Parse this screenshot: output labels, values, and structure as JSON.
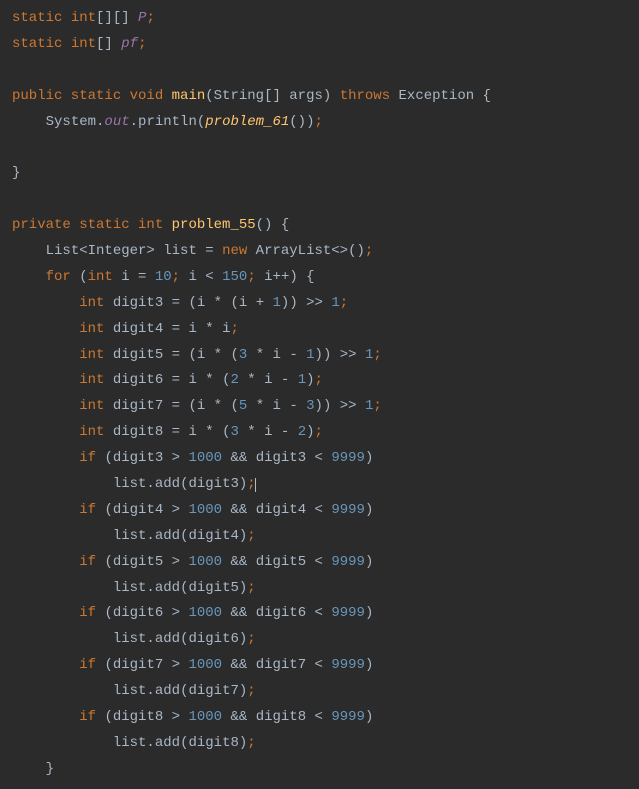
{
  "lines": {
    "l1": {
      "kw1": "static ",
      "kw2": "int",
      "br": "[][] ",
      "id": "P",
      "sc": ";"
    },
    "l2": {
      "kw1": "static ",
      "kw2": "int",
      "br": "[] ",
      "id": "pf",
      "sc": ";"
    },
    "l3": {
      "kw1": "public static ",
      "kw2": "void ",
      "mt": "main",
      "p1": "(",
      "t1": "String[] ",
      "id": "args",
      "p2": ") ",
      "kw3": "throws ",
      "t2": "Exception ",
      "br": "{"
    },
    "l4": {
      "indent": "    ",
      "id1": "System.",
      "fd": "out",
      "dot": ".",
      "mt": "println",
      "p1": "(",
      "fn": "problem_61",
      "p2": "())",
      "sc": ";"
    },
    "l5": {
      "br": "}"
    },
    "l6": {
      "kw1": "private static ",
      "kw2": "int ",
      "mt": "problem_55",
      "p1": "() ",
      "br": "{"
    },
    "l7": {
      "indent": "    ",
      "t1": "List<Integer> ",
      "id": "list ",
      "op": "= ",
      "kw": "new ",
      "t2": "ArrayList<>()",
      "sc": ";"
    },
    "l8": {
      "indent": "    ",
      "kw1": "for ",
      "p1": "(",
      "kw2": "int ",
      "id1": "i ",
      "op1": "= ",
      "n1": "10",
      "sc1": "; ",
      "id2": "i ",
      "op2": "< ",
      "n2": "150",
      "sc2": "; ",
      "id3": "i++) ",
      "br": "{"
    },
    "l9": {
      "indent": "        ",
      "kw": "int ",
      "id1": "digit3 ",
      "op1": "= ",
      "p1": "(i ",
      "op2": "* ",
      "p2": "(i ",
      "op3": "+ ",
      "n1": "1",
      "p3": ")) ",
      "op4": ">> ",
      "n2": "1",
      "sc": ";"
    },
    "l10": {
      "indent": "        ",
      "kw": "int ",
      "id1": "digit4 ",
      "op1": "= ",
      "id2": "i ",
      "op2": "* ",
      "id3": "i",
      "sc": ";"
    },
    "l11": {
      "indent": "        ",
      "kw": "int ",
      "id1": "digit5 ",
      "op1": "= ",
      "p1": "(i ",
      "op2": "* ",
      "p2": "(",
      "n1": "3 ",
      "op3": "* ",
      "id2": "i ",
      "op4": "- ",
      "n2": "1",
      "p3": ")) ",
      "op5": ">> ",
      "n3": "1",
      "sc": ";"
    },
    "l12": {
      "indent": "        ",
      "kw": "int ",
      "id1": "digit6 ",
      "op1": "= ",
      "id2": "i ",
      "op2": "* ",
      "p1": "(",
      "n1": "2 ",
      "op3": "* ",
      "id3": "i ",
      "op4": "- ",
      "n2": "1",
      "p2": ")",
      "sc": ";"
    },
    "l13": {
      "indent": "        ",
      "kw": "int ",
      "id1": "digit7 ",
      "op1": "= ",
      "p1": "(i ",
      "op2": "* ",
      "p2": "(",
      "n1": "5 ",
      "op3": "* ",
      "id2": "i ",
      "op4": "- ",
      "n2": "3",
      "p3": ")) ",
      "op5": ">> ",
      "n3": "1",
      "sc": ";"
    },
    "l14": {
      "indent": "        ",
      "kw": "int ",
      "id1": "digit8 ",
      "op1": "= ",
      "id2": "i ",
      "op2": "* ",
      "p1": "(",
      "n1": "3 ",
      "op3": "* ",
      "id3": "i ",
      "op4": "- ",
      "n2": "2",
      "p2": ")",
      "sc": ";"
    },
    "l15": {
      "indent": "        ",
      "kw": "if ",
      "p1": "(digit3 ",
      "op1": "> ",
      "n1": "1000 ",
      "op2": "&& ",
      "id": "digit3 ",
      "op3": "< ",
      "n2": "9999",
      "p2": ")"
    },
    "l16": {
      "indent": "            ",
      "id": "list.",
      "mt": "add",
      "p1": "(digit3)",
      "sc": ";"
    },
    "l17": {
      "indent": "        ",
      "kw": "if ",
      "p1": "(digit4 ",
      "op1": "> ",
      "n1": "1000 ",
      "op2": "&& ",
      "id": "digit4 ",
      "op3": "< ",
      "n2": "9999",
      "p2": ")"
    },
    "l18": {
      "indent": "            ",
      "id": "list.",
      "mt": "add",
      "p1": "(digit4)",
      "sc": ";"
    },
    "l19": {
      "indent": "        ",
      "kw": "if ",
      "p1": "(digit5 ",
      "op1": "> ",
      "n1": "1000 ",
      "op2": "&& ",
      "id": "digit5 ",
      "op3": "< ",
      "n2": "9999",
      "p2": ")"
    },
    "l20": {
      "indent": "            ",
      "id": "list.",
      "mt": "add",
      "p1": "(digit5)",
      "sc": ";"
    },
    "l21": {
      "indent": "        ",
      "kw": "if ",
      "p1": "(digit6 ",
      "op1": "> ",
      "n1": "1000 ",
      "op2": "&& ",
      "id": "digit6 ",
      "op3": "< ",
      "n2": "9999",
      "p2": ")"
    },
    "l22": {
      "indent": "            ",
      "id": "list.",
      "mt": "add",
      "p1": "(digit6)",
      "sc": ";"
    },
    "l23": {
      "indent": "        ",
      "kw": "if ",
      "p1": "(digit7 ",
      "op1": "> ",
      "n1": "1000 ",
      "op2": "&& ",
      "id": "digit7 ",
      "op3": "< ",
      "n2": "9999",
      "p2": ")"
    },
    "l24": {
      "indent": "            ",
      "id": "list.",
      "mt": "add",
      "p1": "(digit7)",
      "sc": ";"
    },
    "l25": {
      "indent": "        ",
      "kw": "if ",
      "p1": "(digit8 ",
      "op1": "> ",
      "n1": "1000 ",
      "op2": "&& ",
      "id": "digit8 ",
      "op3": "< ",
      "n2": "9999",
      "p2": ")"
    },
    "l26": {
      "indent": "            ",
      "id": "list.",
      "mt": "add",
      "p1": "(digit8)",
      "sc": ";"
    },
    "l27": {
      "indent": "    ",
      "br": "}"
    }
  }
}
